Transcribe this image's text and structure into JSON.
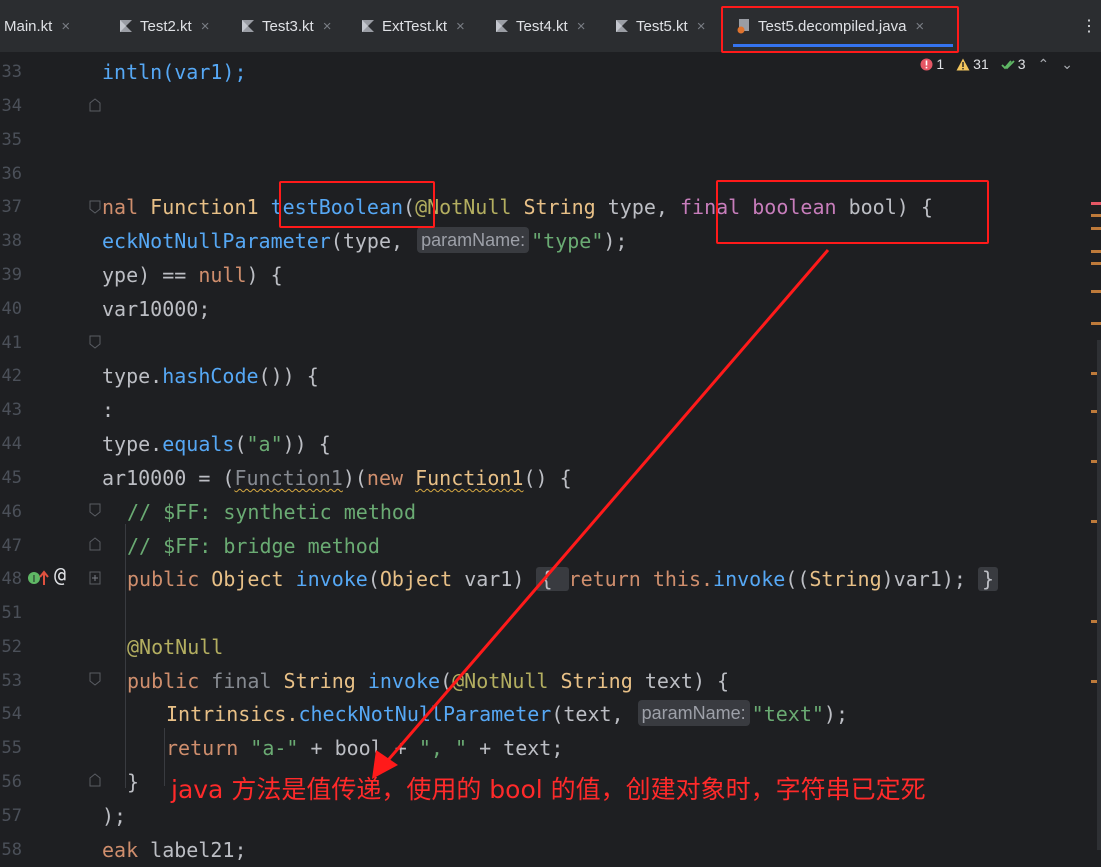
{
  "tabs": [
    {
      "label": "Main.kt"
    },
    {
      "label": "Test2.kt"
    },
    {
      "label": "Test3.kt"
    },
    {
      "label": "ExtTest.kt"
    },
    {
      "label": "Test4.kt"
    },
    {
      "label": "Test5.kt"
    },
    {
      "label": "Test5.decompiled.java"
    }
  ],
  "more_menu": "⋮",
  "inspections": {
    "errors": "1",
    "warnings": "31",
    "ok": "3"
  },
  "gutter": [
    "33",
    "34",
    "35",
    "36",
    "37",
    "38",
    "39",
    "40",
    "41",
    "42",
    "43",
    "44",
    "45",
    "46",
    "47",
    "48",
    "51",
    "52",
    "53",
    "54",
    "55",
    "56",
    "57",
    "58"
  ],
  "code": {
    "l33": "intln(var1);",
    "l37_a": "nal ",
    "l37_b": "Function1 ",
    "l37_c": "testBoolean",
    "l37_d": "(",
    "l37_e": "@NotNull ",
    "l37_f": "String ",
    "l37_g": "type, ",
    "l37_h": "final boolean ",
    "l37_i": "bool",
    "l37_j": ") {",
    "l38_a": "eckNotNullParameter",
    "l38_b": "(type, ",
    "l38_hint": "paramName:",
    "l38_c": "\"type\"",
    "l38_d": ");",
    "l39_a": "ype) == ",
    "l39_b": "null",
    "l39_c": ") {",
    "l40": "var10000;",
    "l42_a": "type.",
    "l42_b": "hashCode",
    "l42_c": "()) {",
    "l43": ":",
    "l44_a": "type.",
    "l44_b": "equals",
    "l44_c": "(",
    "l44_d": "\"a\"",
    "l44_e": ")) {",
    "l45_a": "ar10000 = (",
    "l45_b": "Function1",
    "l45_c": ")(",
    "l45_d": "new ",
    "l45_e": "Function1",
    "l45_f": "() {",
    "l46": "// $FF: synthetic method",
    "l47": "// $FF: bridge method",
    "l48_a": "public ",
    "l48_b": "Object ",
    "l48_c": "invoke",
    "l48_d": "(",
    "l48_e": "Object ",
    "l48_f": "var1) ",
    "l48_g": "{ ",
    "l48_h": "return this.",
    "l48_i": "invoke",
    "l48_j": "((",
    "l48_k": "String",
    "l48_l": ")var1); ",
    "l48_m": "}",
    "l52": "@NotNull",
    "l53_a": "public ",
    "l53_b": "final ",
    "l53_c": "String ",
    "l53_d": "invoke",
    "l53_e": "(",
    "l53_f": "@NotNull ",
    "l53_g": "String ",
    "l53_h": "text) {",
    "l54_a": "Intrinsics.",
    "l54_b": "checkNotNullParameter",
    "l54_c": "(text, ",
    "l54_hint": "paramName:",
    "l54_d": "\"text\"",
    "l54_e": ");",
    "l55_a": "return ",
    "l55_b": "\"a-\"",
    "l55_c": " + bool + ",
    "l55_d": "\", \"",
    "l55_e": " + text;",
    "l56": "}",
    "l57": ");",
    "l58_a": "eak ",
    "l58_b": "label21;"
  },
  "annotation_note": "java 方法是值传递，使用的 bool 的值，创建对象时，字符串已定死",
  "colors": {
    "accent": "#3574f0",
    "annotation": "#ff1a1a",
    "background": "#1e1f22"
  }
}
